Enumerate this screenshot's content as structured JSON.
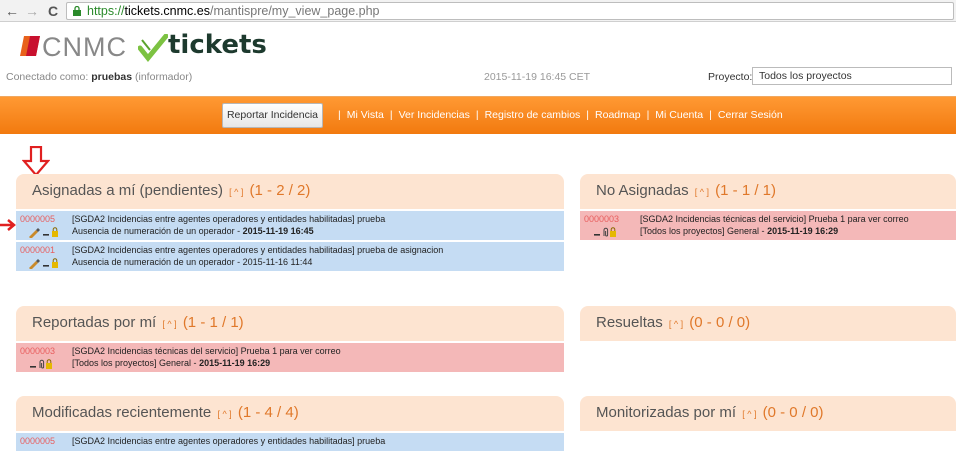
{
  "browser": {
    "url_scheme": "https://",
    "url_host": "tickets.cnmc.es",
    "url_path": "/mantispre/my_view_page.php"
  },
  "brand": {
    "cnmc": "CNMC",
    "tickets": "tickets",
    "accent": "#f27a0f"
  },
  "login": {
    "prefix": "Conectado como:",
    "user": "pruebas",
    "role": "(informador)",
    "datetime": "2015-11-19 16:45 CET",
    "project_label": "Proyecto:",
    "project_value": "Todos los proyectos"
  },
  "menu": {
    "report_button": "Reportar Incidencia",
    "links": [
      "Mi Vista",
      "Ver Incidencias",
      "Registro de cambios",
      "Roadmap",
      "Mi Cuenta",
      "Cerrar Sesión"
    ],
    "separator": "|"
  },
  "panels": {
    "assigned": {
      "title": "Asignadas a mí (pendientes)",
      "toggle": "[ ^ ]",
      "count": "(1 - 2 / 2)",
      "rows": [
        {
          "id": "0000005",
          "line1": "[SGDA2 Incidencias entre agentes operadores y entidades habilitadas] prueba",
          "line2": "Ausencia de numeración de un operador -",
          "date": "2015-11-19 16:45",
          "date_bold": true
        },
        {
          "id": "0000001",
          "line1": "[SGDA2 Incidencias entre agentes operadores y entidades habilitadas] prueba de asignacion",
          "line2": "Ausencia de numeración de un operador -",
          "date": "2015-11-16 11:44",
          "date_bold": false
        }
      ]
    },
    "unassigned": {
      "title": "No Asignadas",
      "toggle": "[ ^ ]",
      "count": "(1 - 1 / 1)",
      "rows": [
        {
          "id": "0000003",
          "line1": "[SGDA2 Incidencias técnicas del servicio] Prueba 1 para ver correo",
          "line2": "[Todos los proyectos] General -",
          "date": "2015-11-19 16:29"
        }
      ]
    },
    "reported": {
      "title": "Reportadas por mí",
      "toggle": "[ ^ ]",
      "count": "(1 - 1 / 1)",
      "rows": [
        {
          "id": "0000003",
          "line1": "[SGDA2 Incidencias técnicas del servicio] Prueba 1 para ver correo",
          "line2": "[Todos los proyectos] General -",
          "date": "2015-11-19 16:29"
        }
      ]
    },
    "resolved": {
      "title": "Resueltas",
      "toggle": "[ ^ ]",
      "count": "(0 - 0 / 0)"
    },
    "recent": {
      "title": "Modificadas recientemente",
      "toggle": "[ ^ ]",
      "count": "(1 - 4 / 4)",
      "rows": [
        {
          "id": "0000005",
          "line1": "[SGDA2 Incidencias entre agentes operadores y entidades habilitadas] prueba"
        }
      ]
    },
    "monitored": {
      "title": "Monitorizadas por mí",
      "toggle": "[ ^ ]",
      "count": "(0 - 0 / 0)"
    }
  },
  "icons": {
    "edit": "pencil-icon",
    "priority": "priority-dash-icon",
    "lock": "lock-icon",
    "attachment": "paperclip-icon"
  },
  "colors": {
    "row_assigned": "#c5dcf3",
    "row_unassigned": "#f4b8b8",
    "panel_header": "#fde4d1",
    "annotation": "#e02020"
  }
}
